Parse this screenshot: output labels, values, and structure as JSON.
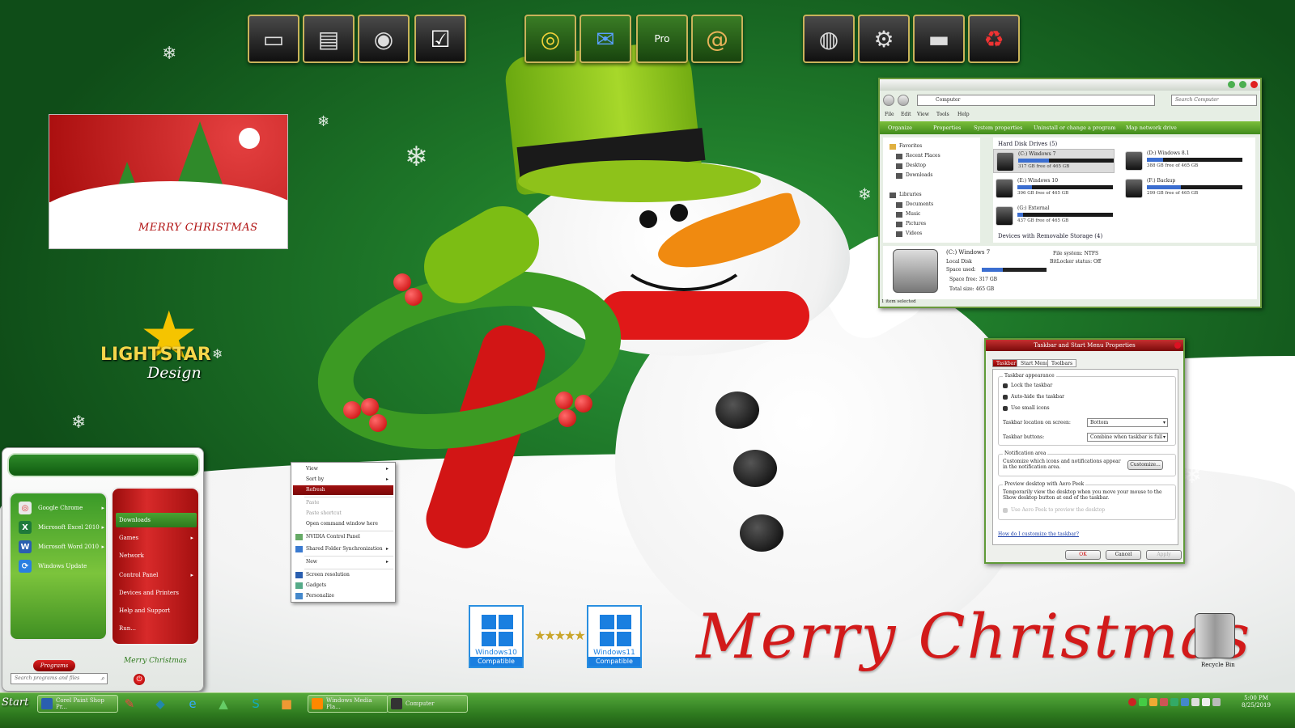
{
  "dock": {
    "group1": [
      "computer-icon",
      "documents-icon",
      "network-icon",
      "control-panel-icon"
    ],
    "group2": [
      "chrome-icon",
      "thunderbird-icon",
      "google-earth-pro-icon",
      "address-book-icon"
    ],
    "group3": [
      "media-player-icon",
      "settings-icon",
      "folder-icon",
      "recycle-icon"
    ],
    "earth_label": "Pro"
  },
  "card": {
    "text": "MERRY CHRISTMAS"
  },
  "logo": {
    "main": "LIGHTSTAR",
    "sub": "Design"
  },
  "start_menu": {
    "left_items": [
      {
        "label": "Google Chrome",
        "icon": "chrome-icon",
        "color": "#ffffff"
      },
      {
        "label": "Microsoft Excel 2010",
        "icon": "excel-icon",
        "color": "#1f7a3a"
      },
      {
        "label": "Microsoft Word 2010",
        "icon": "word-icon",
        "color": "#2a5fb0"
      },
      {
        "label": "Windows Update",
        "icon": "windows-update-icon",
        "color": "#2a7fe0"
      }
    ],
    "right_items": [
      "Downloads",
      "Games",
      "Network",
      "Control Panel",
      "Devices and Printers",
      "Help and Support",
      "Run..."
    ],
    "programs_label": "Programs",
    "merry_label": "Merry Christmas",
    "search_placeholder": "Search programs and files"
  },
  "context_menu": {
    "items": [
      "View",
      "Sort by",
      "Refresh",
      "Paste",
      "Paste shortcut",
      "Open command window here",
      "NVIDIA Control Panel",
      "Shared Folder Synchronization",
      "New",
      "Screen resolution",
      "Gadgets",
      "Personalize"
    ],
    "highlighted": "Refresh"
  },
  "explorer": {
    "address": "Computer",
    "search_placeholder": "Search Computer",
    "menu": [
      "File",
      "Edit",
      "View",
      "Tools",
      "Help"
    ],
    "commands": [
      "Organize",
      "Properties",
      "System properties",
      "Uninstall or change a program",
      "Map network drive"
    ],
    "nav": {
      "favorites": "Favorites",
      "fav_items": [
        "Recent Places",
        "Desktop",
        "Downloads"
      ],
      "libraries": "Libraries",
      "lib_items": [
        "Documents",
        "Music",
        "Pictures",
        "Videos"
      ]
    },
    "section_hdd": "Hard Disk Drives (5)",
    "drives": [
      {
        "name": "(C:) Windows 7",
        "free": "317 GB free of 465 GB",
        "used": 0.32
      },
      {
        "name": "(D:) Windows 8.1",
        "free": "388 GB free of 465 GB",
        "used": 0.17
      },
      {
        "name": "(E:) Windows 10",
        "free": "396 GB free of 465 GB",
        "used": 0.15
      },
      {
        "name": "(F:) Backup",
        "free": "299 GB free of 465 GB",
        "used": 0.36
      },
      {
        "name": "(G:) External",
        "free": "437 GB free of 465 GB",
        "used": 0.06
      }
    ],
    "section_removable": "Devices with Removable Storage (4)",
    "details": {
      "name": "(C:) Windows 7",
      "type": "Local Disk",
      "space_used_label": "Space used:",
      "space_free": "Space free: 317 GB",
      "total_size": "Total size: 465 GB",
      "filesystem": "File system: NTFS",
      "bitlocker": "BitLocker status: Off"
    },
    "status": "1 item selected"
  },
  "dialog": {
    "title": "Taskbar and Start Menu Properties",
    "tabs": [
      "Taskbar",
      "Start Menu",
      "Toolbars"
    ],
    "appearance": "Taskbar appearance",
    "checks": [
      "Lock the taskbar",
      "Auto-hide the taskbar",
      "Use small icons"
    ],
    "location_label": "Taskbar location on screen:",
    "location_value": "Bottom",
    "buttons_label": "Taskbar buttons:",
    "buttons_value": "Combine when taskbar is full",
    "notification": "Notification area",
    "notification_text": "Customize which icons and notifications appear in the notification area.",
    "customize": "Customize...",
    "peek": "Preview desktop with Aero Peek",
    "peek_text": "Temporarily view the desktop when you move your mouse to the Show desktop button at end of the taskbar.",
    "peek_check": "Use Aero Peek to preview the desktop",
    "help_link": "How do I customize the taskbar?",
    "ok": "OK",
    "cancel": "Cancel",
    "apply": "Apply"
  },
  "badges": [
    {
      "name": "Windows10",
      "compat": "Compatible"
    },
    {
      "name": "Windows11",
      "compat": "Compatible"
    }
  ],
  "merry_big": "Merry Christmas",
  "recycle_label": "Recycle Bin",
  "taskbar": {
    "start": "Start",
    "apps": [
      "Corel Paint Shop Pr...",
      "Windows Media Pla...",
      "Computer"
    ],
    "pins": [
      "paint-icon",
      "cube-icon",
      "ie-icon",
      "share-icon",
      "skype-icon",
      "package-icon"
    ],
    "time": "5:00 PM",
    "date": "8/25/2019"
  }
}
